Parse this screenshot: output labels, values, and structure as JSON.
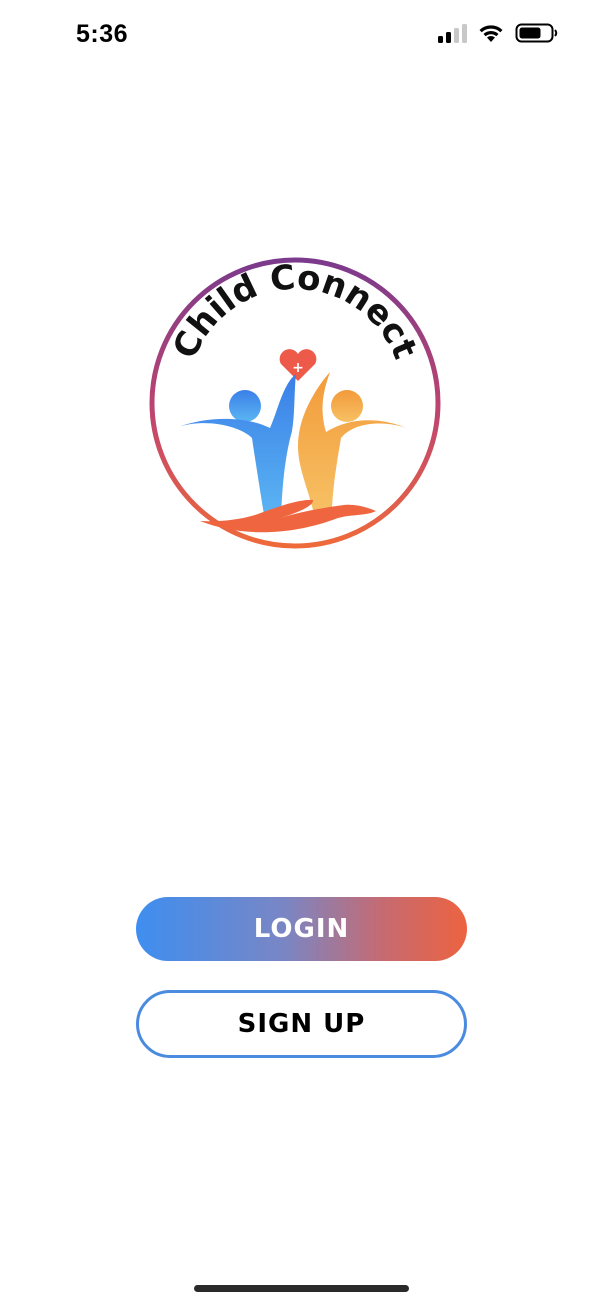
{
  "status_bar": {
    "time": "5:36",
    "icons": [
      "signal-icon",
      "wifi-icon",
      "battery-icon"
    ]
  },
  "logo": {
    "brand_text": "Child Connect",
    "heart_symbol": "+",
    "colors": {
      "ring_top": "#7b3a8c",
      "ring_bottom": "#ef6a3a",
      "blue_figure": "#3e8ef0",
      "orange_figure": "#f2a63a",
      "hand": "#ee6540",
      "heart": "#ee5a4a"
    }
  },
  "buttons": {
    "login_label": "LOGIN",
    "signup_label": "SIGN UP"
  },
  "colors": {
    "login_gradient_start": "#3e8ef0",
    "login_gradient_end": "#ec6340",
    "signup_border": "#4a8be0"
  }
}
